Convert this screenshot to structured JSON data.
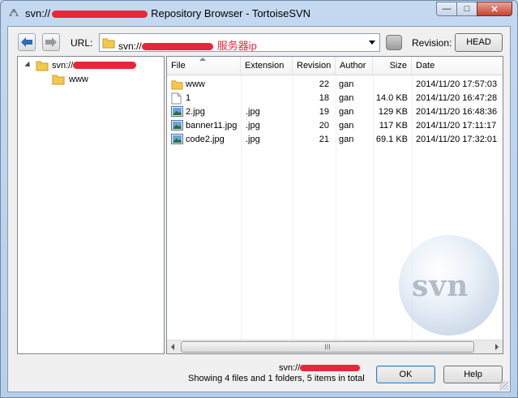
{
  "window": {
    "title_prefix": "svn://",
    "title_suffix": "Repository Browser - TortoiseSVN",
    "caption_buttons": {
      "minimize": "—",
      "maximize": "□",
      "close": "✕"
    }
  },
  "toolbar": {
    "url_label": "URL:",
    "url_value": "svn://",
    "url_annotation": "服务器ip",
    "revision_label": "Revision:",
    "head_button": "HEAD"
  },
  "tree": {
    "root_label": "svn://",
    "child_label": "www"
  },
  "list": {
    "columns": [
      "File",
      "Extension",
      "Revision",
      "Author",
      "Size",
      "Date"
    ],
    "rows": [
      {
        "icon": "folder-icon",
        "file": "www",
        "ext": "",
        "rev": "22",
        "author": "gan",
        "size": "",
        "date": "2014/11/20 17:57:03"
      },
      {
        "icon": "file-icon",
        "file": "1",
        "ext": "",
        "rev": "18",
        "author": "gan",
        "size": "14.0 KB",
        "date": "2014/11/20 16:47:28"
      },
      {
        "icon": "image-icon",
        "file": "2.jpg",
        "ext": ".jpg",
        "rev": "19",
        "author": "gan",
        "size": "129 KB",
        "date": "2014/11/20 16:48:36"
      },
      {
        "icon": "image-icon",
        "file": "banner11.jpg",
        "ext": ".jpg",
        "rev": "20",
        "author": "gan",
        "size": "117 KB",
        "date": "2014/11/20 17:11:17"
      },
      {
        "icon": "image-icon",
        "file": "code2.jpg",
        "ext": ".jpg",
        "rev": "21",
        "author": "gan",
        "size": "69.1 KB",
        "date": "2014/11/20 17:32:01"
      }
    ],
    "watermark": "svn",
    "scrollbar_grip": "III"
  },
  "status": {
    "path": "svn://",
    "summary": "Showing 4 files and 1 folders, 5 items in total"
  },
  "buttons": {
    "ok": "OK",
    "help": "Help"
  },
  "colors": {
    "redaction": "#e8263a",
    "annotation": "#e8263a",
    "close_button": "#c7432f"
  }
}
